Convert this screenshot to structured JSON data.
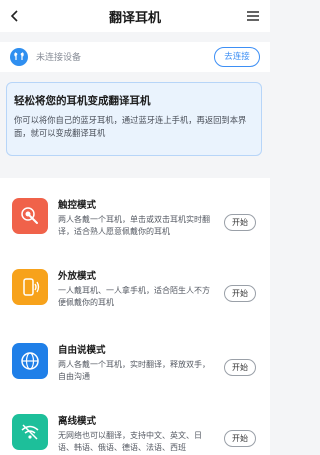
{
  "header": {
    "title": "翻译耳机",
    "back_icon": "chevron-left-icon",
    "menu_icon": "menu-lines-icon"
  },
  "device": {
    "status": "未连接设备",
    "connect_label": "去连接",
    "icon": "earphone-icon"
  },
  "banner": {
    "title": "轻松将您的耳机变成翻译耳机",
    "text": "你可以将你自己的蓝牙耳机，通过蓝牙连上手机，再返回到本界面，就可以变成翻译耳机"
  },
  "modes": [
    {
      "title": "触控模式",
      "desc": "两人各戴一个耳机，单击或双击耳机实时翻译，适合熟人愿意佩戴你的耳机",
      "start_label": "开始",
      "icon": "touch-icon",
      "color": "#f0624a"
    },
    {
      "title": "外放模式",
      "desc": "一人戴耳机、一人拿手机，适合陌生人不方便佩戴你的耳机",
      "start_label": "开始",
      "icon": "speaker-phone-icon",
      "color": "#f7a21b"
    },
    {
      "title": "自由说模式",
      "desc": "两人各戴一个耳机，实时翻译，释放双手，自由沟通",
      "start_label": "开始",
      "icon": "globe-icon",
      "color": "#1f7fe8"
    },
    {
      "title": "离线模式",
      "desc": "无网络也可以翻译，支持中文、英文、日语、韩语、俄语、德语、法语、西班",
      "start_label": "开始",
      "icon": "wifi-off-icon",
      "color": "#1dbf9a"
    }
  ]
}
